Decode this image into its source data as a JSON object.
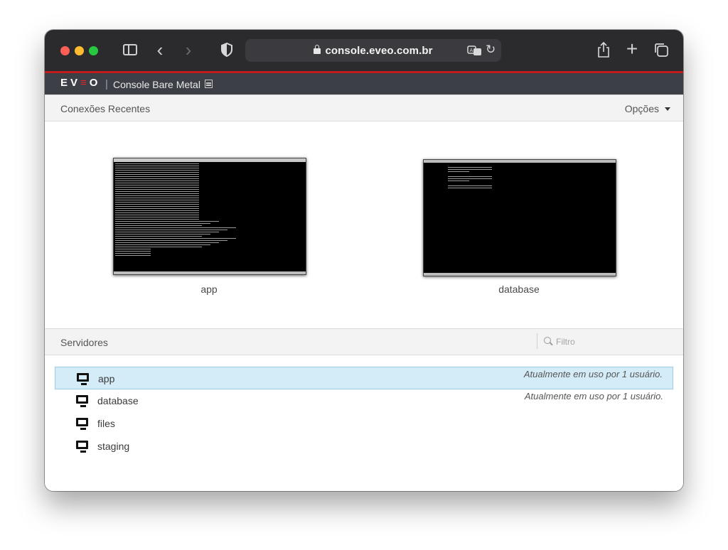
{
  "browser": {
    "url": "console.eveo.com.br"
  },
  "app": {
    "logo": "EV≡O",
    "logo_left": "EV",
    "logo_mid": "≡",
    "logo_right": "O",
    "separator": "|",
    "title": "Console Bare Metal"
  },
  "recent": {
    "title": "Conexões Recentes",
    "options_label": "Opções",
    "items": [
      {
        "label": "app"
      },
      {
        "label": "database"
      }
    ]
  },
  "servers": {
    "title": "Servidores",
    "filter_placeholder": "Filtro",
    "items": [
      {
        "name": "app",
        "status": "Atualmente em uso por 1 usuário.",
        "selected": true
      },
      {
        "name": "database",
        "status": "Atualmente em uso por 1 usuário.",
        "selected": false
      },
      {
        "name": "files",
        "status": "",
        "selected": false
      },
      {
        "name": "staging",
        "status": "",
        "selected": false
      }
    ]
  },
  "colors": {
    "accent_red": "#c11b1b",
    "selected_row": "#d4ecf7",
    "toolbar": "#2b2b2e"
  },
  "icons": [
    "sidebar-icon",
    "back-icon",
    "forward-icon",
    "shield-icon",
    "lock-icon",
    "translate-icon",
    "reload-icon",
    "share-icon",
    "plus-icon",
    "tabs-icon",
    "server-rack-icon",
    "caret-down-icon",
    "search-icon",
    "monitor-icon"
  ]
}
